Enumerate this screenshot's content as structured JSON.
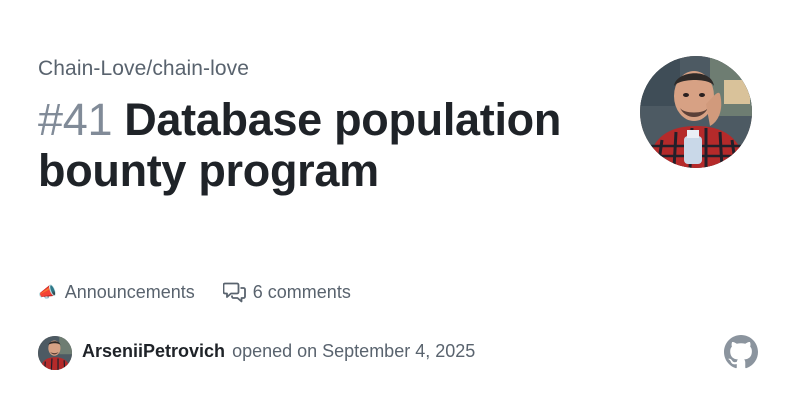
{
  "repo": {
    "full_name": "Chain-Love/chain-love"
  },
  "issue": {
    "number": "#41",
    "title": "Database population bounty program"
  },
  "meta": {
    "category_emoji": "📣",
    "category_label": "Announcements",
    "comments_label": "6 comments"
  },
  "author": {
    "username": "ArseniiPetrovich",
    "action_text": "opened on September 4, 2025"
  },
  "icons": {
    "comment": "comment-discussion-icon",
    "brand": "github-mark-icon",
    "megaphone": "megaphone-icon"
  },
  "colors": {
    "text_primary": "#1f2328",
    "text_muted": "#59636e",
    "number_muted": "#818b98",
    "background": "#ffffff"
  }
}
